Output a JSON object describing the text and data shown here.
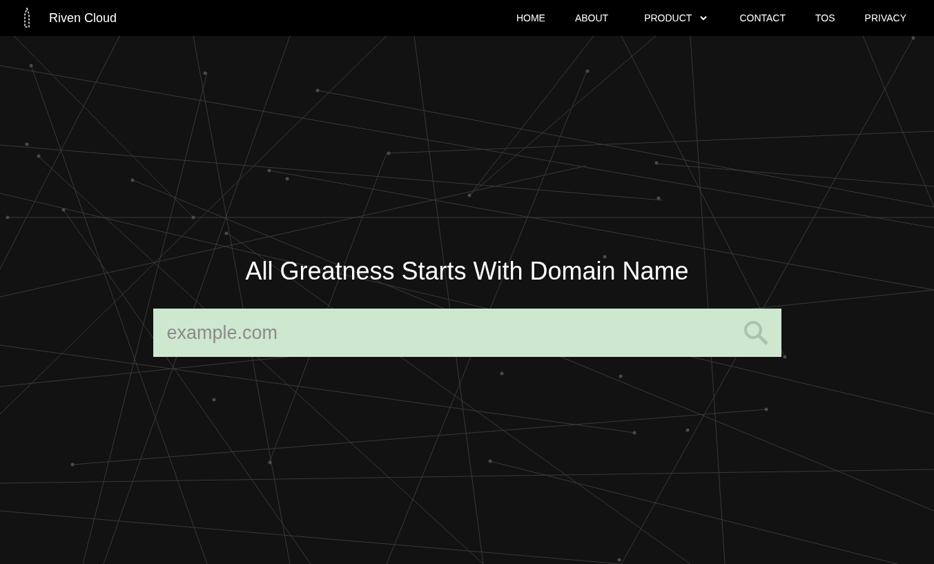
{
  "navbar": {
    "brand": "Riven Cloud",
    "items": [
      {
        "label": "HOME",
        "kind": "link"
      },
      {
        "label": "ABOUT",
        "kind": "link"
      },
      {
        "label": "PRODUCT",
        "kind": "dropdown"
      },
      {
        "label": "CONTACT",
        "kind": "link"
      },
      {
        "label": "TOS",
        "kind": "link"
      },
      {
        "label": "PRIVACY",
        "kind": "link"
      }
    ]
  },
  "hero": {
    "title": "All Greatness Starts With Domain Name",
    "search": {
      "placeholder": "example.com"
    }
  }
}
